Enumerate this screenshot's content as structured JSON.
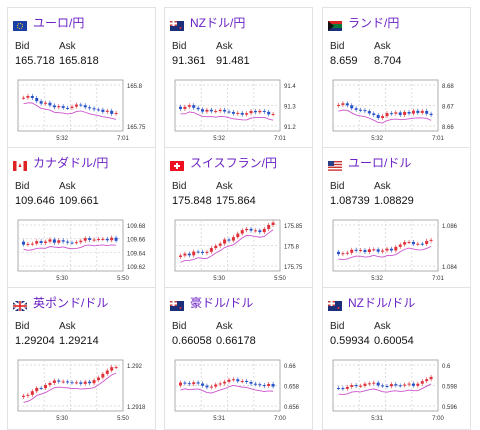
{
  "labels": {
    "bid": "Bid",
    "ask": "Ask"
  },
  "cards": [
    {
      "title": "ユーロ/円",
      "flag": "eu",
      "bid": "165.718",
      "ask": "165.818",
      "yticks": [
        "165.8",
        "165.75"
      ],
      "xticks": [
        "5:32",
        "7:01"
      ]
    },
    {
      "title": "NZドル/円",
      "flag": "nz",
      "bid": "91.361",
      "ask": "91.481",
      "yticks": [
        "91.4",
        "91.3",
        "91.2"
      ],
      "xticks": [
        "5:32",
        "7:01"
      ]
    },
    {
      "title": "ランド/円",
      "flag": "za",
      "bid": "8.659",
      "ask": "8.704",
      "yticks": [
        "8.68",
        "8.67",
        "8.66"
      ],
      "xticks": [
        "5:32",
        "7:01"
      ]
    },
    {
      "title": "カナダドル/円",
      "flag": "ca",
      "bid": "109.646",
      "ask": "109.661",
      "yticks": [
        "109.68",
        "109.66",
        "109.64",
        "109.62"
      ],
      "xticks": [
        "5:30",
        "5:50"
      ]
    },
    {
      "title": "スイスフラン/円",
      "flag": "ch",
      "bid": "175.848",
      "ask": "175.864",
      "yticks": [
        "175.85",
        "175.8",
        "175.75"
      ],
      "xticks": [
        "5:30",
        "5:50"
      ]
    },
    {
      "title": "ユーロ/ドル",
      "flag": "us",
      "bid": "1.08739",
      "ask": "1.08829",
      "yticks": [
        "1.086",
        "1.084"
      ],
      "xticks": [
        "5:32",
        "7:01"
      ]
    },
    {
      "title": "英ポンド/ドル",
      "flag": "uk",
      "bid": "1.29204",
      "ask": "1.29214",
      "yticks": [
        "1.292",
        "1.2918"
      ],
      "xticks": [
        "5:30",
        "5:50"
      ]
    },
    {
      "title": "豪ドル/ドル",
      "flag": "au",
      "bid": "0.66058",
      "ask": "0.66178",
      "yticks": [
        "0.66",
        "0.658",
        "0.656"
      ],
      "xticks": [
        "5:31",
        "7:00"
      ]
    },
    {
      "title": "NZドル/ドル",
      "flag": "nz",
      "bid": "0.59934",
      "ask": "0.60054",
      "yticks": [
        "0.6",
        "0.598",
        "0.596"
      ],
      "xticks": [
        "5:31",
        "7:00"
      ]
    }
  ]
}
